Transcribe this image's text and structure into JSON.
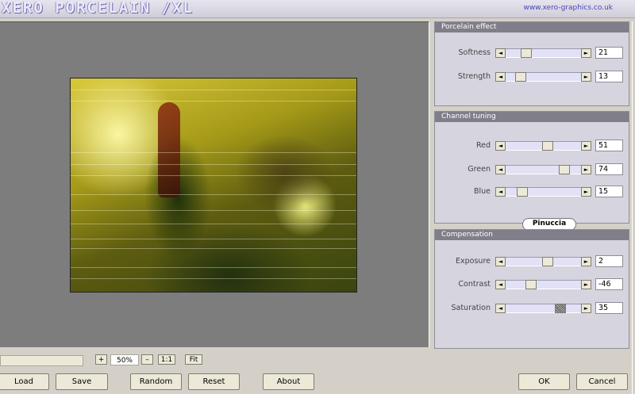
{
  "header": {
    "brand": "XERO PORCELAIN /XL",
    "site": "www.xero-graphics.co.uk"
  },
  "zoom": {
    "plus_label": "+",
    "value": "50%",
    "minus_label": "–",
    "one_to_one_label": "1:1",
    "fit_label": "Fit"
  },
  "buttons": {
    "load": "Load",
    "save": "Save",
    "random": "Random",
    "reset": "Reset",
    "about": "About",
    "ok": "OK",
    "cancel": "Cancel"
  },
  "porcelain": {
    "title": "Porcelain effect",
    "softness": {
      "label": "Softness",
      "value": "21",
      "level": 0.21
    },
    "strength": {
      "label": "Strength",
      "value": "13",
      "level": 0.13
    }
  },
  "channel": {
    "title": "Channel tuning",
    "red": {
      "label": "Red",
      "value": "51",
      "level": 0.51
    },
    "green": {
      "label": "Green",
      "value": "74",
      "level": 0.74
    },
    "blue": {
      "label": "Blue",
      "value": "15",
      "level": 0.15
    }
  },
  "watermark": "Pinuccia",
  "compensation": {
    "title": "Compensation",
    "exposure": {
      "label": "Exposure",
      "value": "2",
      "level": 0.51
    },
    "contrast": {
      "label": "Contrast",
      "value": "-46",
      "level": 0.27
    },
    "saturation": {
      "label": "Saturation",
      "value": "35",
      "level": 0.68
    }
  },
  "icons": {
    "left_arrow": "arrow-left-icon",
    "right_arrow": "arrow-right-icon"
  }
}
